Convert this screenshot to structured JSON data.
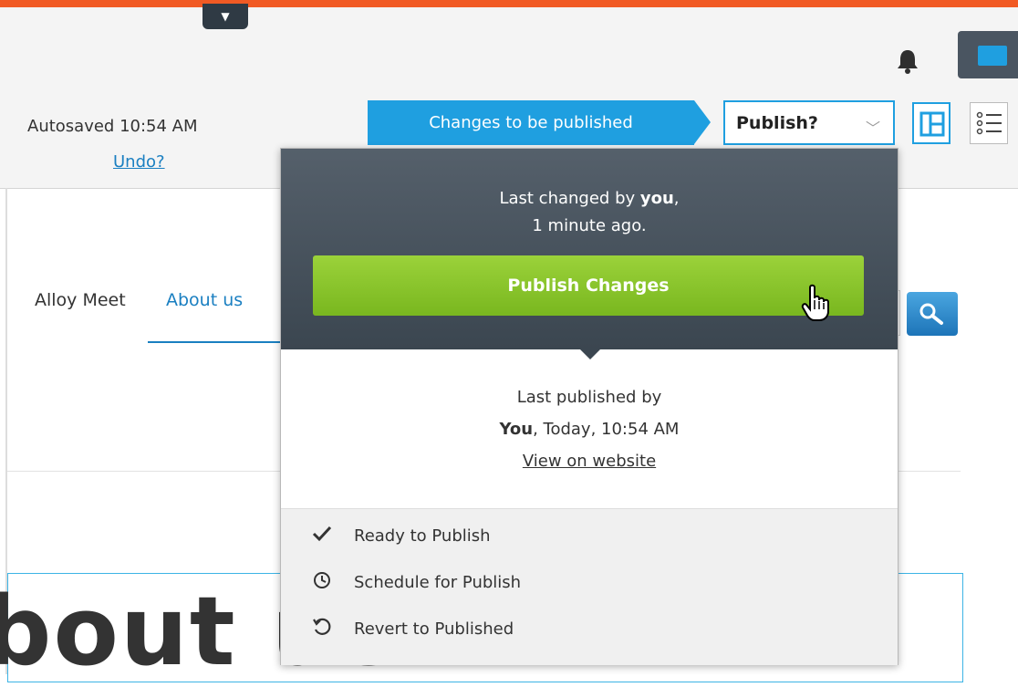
{
  "global": {
    "toggle_icon": "caret-down-icon",
    "bell_icon": "bell-icon",
    "folder_icon": "folder-icon"
  },
  "toolbar": {
    "autosaved": "Autosaved 10:54 AM",
    "undo": "Undo?",
    "status_tag": "Changes to be published",
    "publish_select": "Publish?",
    "accent_color": "#1f9fe0"
  },
  "site": {
    "nav": [
      "Alloy Meet",
      "About us"
    ],
    "heading": "bout us"
  },
  "popover": {
    "last_changed_prefix": "Last changed by ",
    "last_changed_user": "you",
    "last_changed_suffix": ",",
    "last_changed_time": "1 minute ago.",
    "publish_button": "Publish Changes",
    "last_published_label": "Last published by",
    "last_published_user": "You",
    "last_published_time": ", Today, 10:54 AM",
    "view_on_website": "View on website",
    "actions": [
      {
        "label": "Ready to Publish",
        "icon": "checkmark-icon"
      },
      {
        "label": "Schedule for Publish",
        "icon": "clock-icon"
      },
      {
        "label": "Revert to Published",
        "icon": "revert-icon"
      }
    ],
    "button_color": "#8cc63f"
  }
}
